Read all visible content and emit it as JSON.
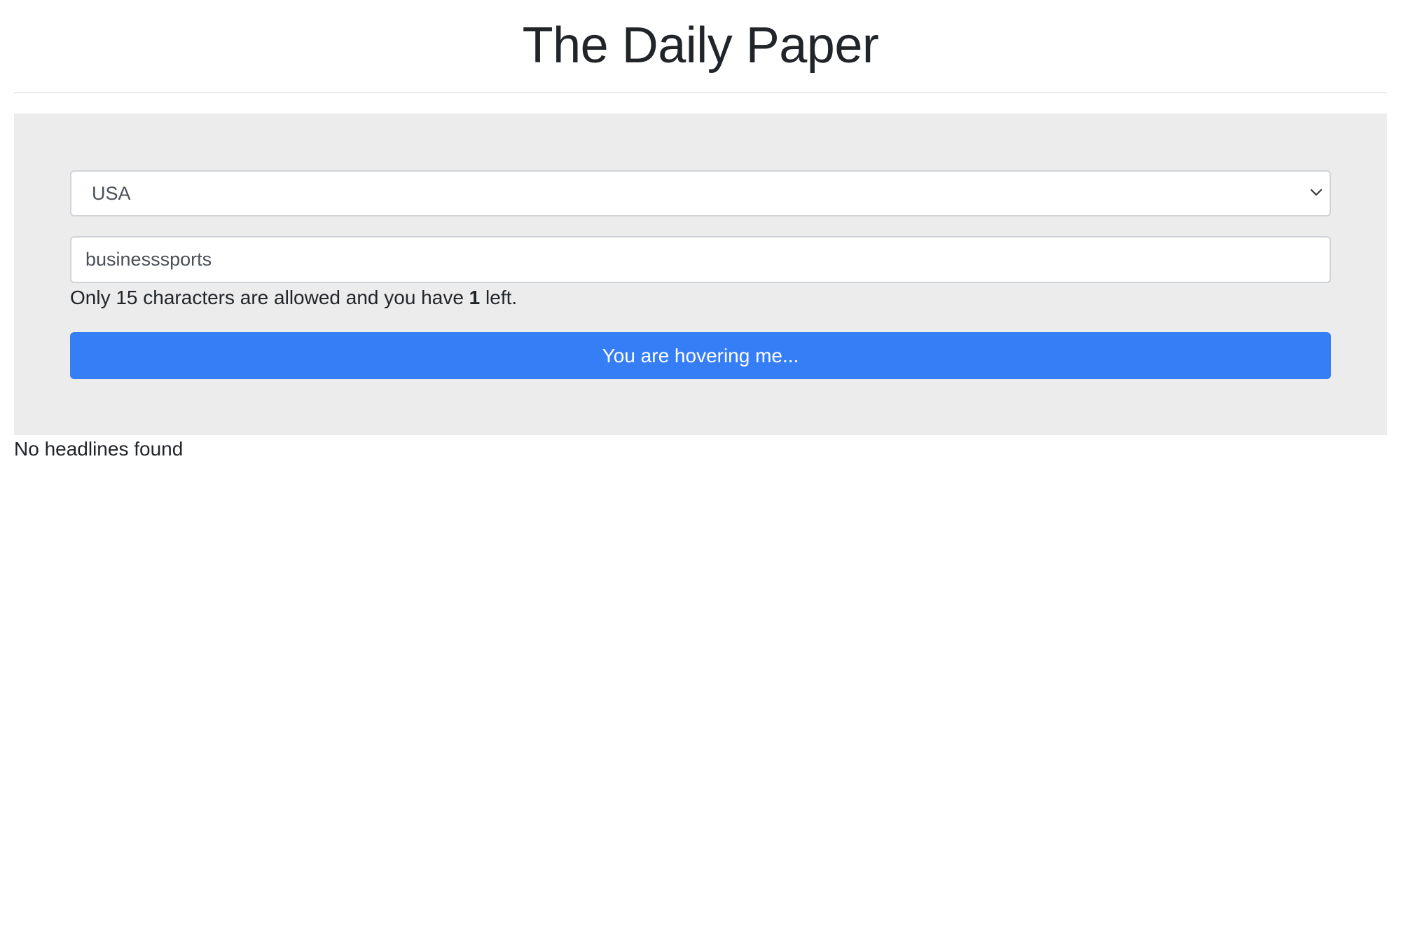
{
  "header": {
    "title": "The Daily Paper"
  },
  "form": {
    "country": {
      "selected": "USA",
      "icon": "chevron-down-icon"
    },
    "category": {
      "value": "businesssports"
    },
    "counter": {
      "prefix": "Only 15 characters are allowed and you have ",
      "remaining": "1",
      "suffix": " left."
    },
    "button": {
      "label": "You are hovering me..."
    }
  },
  "results": {
    "empty_message": "No headlines found"
  },
  "colors": {
    "accent": "#357ef5",
    "panel_background": "#ececec",
    "text": "#212529"
  }
}
